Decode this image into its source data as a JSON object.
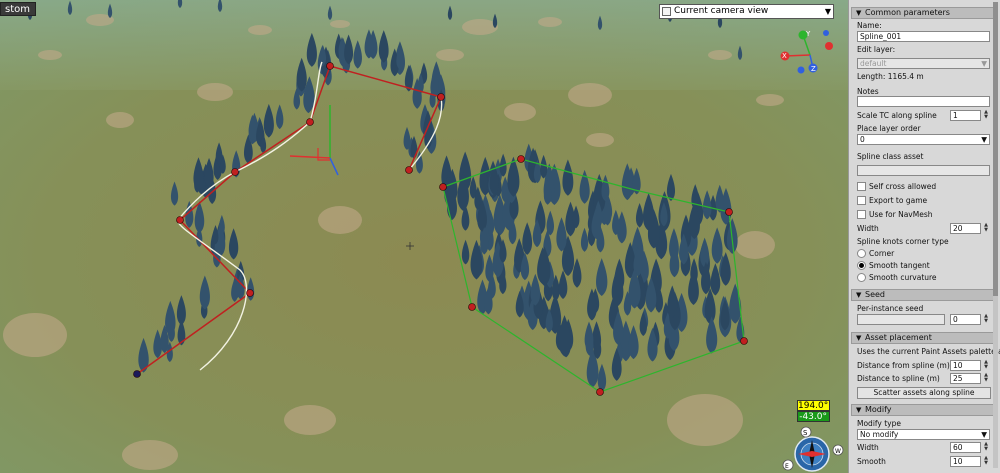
{
  "viewport": {
    "tab_label": "stom",
    "camera_select": "Current camera view",
    "angles": [
      "194.0°",
      "-43.0°"
    ],
    "colors": {
      "ground": "#8a8a5a",
      "tree": "#2b4760",
      "spline_red": "#c02020",
      "spline_white": "#f0f0e0",
      "spline_green": "#22aa22",
      "angle_yellow": "#ffff00",
      "angle_green": "#1a9a1a"
    },
    "gizmo": {
      "axis_y": "Y",
      "axis_x": "X",
      "axis_z": "Z"
    },
    "compass": {
      "north": "S",
      "west": "W",
      "east": "E"
    }
  },
  "panel": {
    "common": {
      "title": "Common parameters",
      "name_label": "Name:",
      "name_value": "Spline_001",
      "edit_layer_label": "Edit layer:",
      "edit_layer_value": "default",
      "length_text": "Length: 1165.4 m",
      "notes_label": "Notes",
      "notes_value": "",
      "scale_tc_label": "Scale TC along spline",
      "scale_tc_value": "1",
      "place_layer_label": "Place layer order",
      "place_layer_value": "0",
      "spline_class_label": "Spline class asset",
      "spline_class_value": "",
      "self_cross_label": "Self cross allowed",
      "export_label": "Export to game",
      "navmesh_label": "Use for NavMesh",
      "width_label": "Width",
      "width_value": "20",
      "corner_type_label": "Spline knots corner type",
      "corner_options": [
        "Corner",
        "Smooth tangent",
        "Smooth curvature"
      ],
      "corner_selected": 1
    },
    "seed": {
      "title": "Seed",
      "per_instance_label": "Per-instance seed",
      "seed_value": "0"
    },
    "placement": {
      "title": "Asset placement",
      "info_text": "Uses the current Paint Assets palette and...",
      "dist_from_label": "Distance from spline (m)",
      "dist_from_value": "10",
      "dist_to_label": "Distance to spline (m)",
      "dist_to_value": "25",
      "scatter_button": "Scatter assets along spline"
    },
    "modify": {
      "title": "Modify",
      "type_label": "Modify type",
      "type_value": "No modify",
      "width_label": "Width",
      "width_value": "60",
      "smooth_label": "Smooth",
      "smooth_value": "10"
    }
  }
}
